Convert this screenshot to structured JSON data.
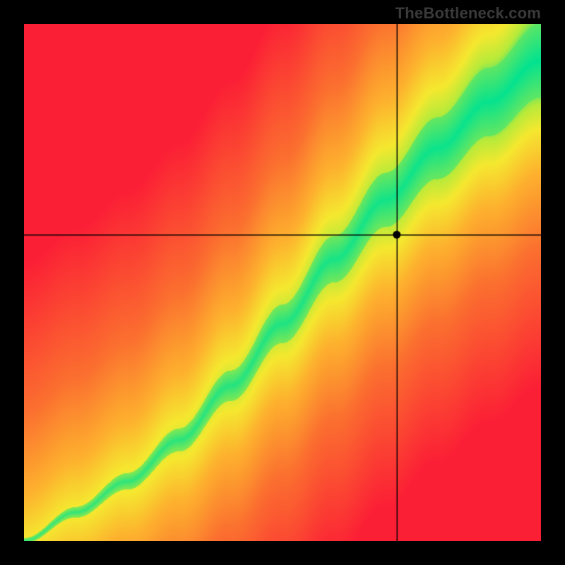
{
  "watermark": "TheBottleneck.com",
  "chart_data": {
    "type": "heatmap",
    "title": "",
    "xlabel": "",
    "ylabel": "",
    "xlim": [
      0,
      1
    ],
    "ylim": [
      0,
      1
    ],
    "marker": {
      "x": 0.722,
      "y": 0.592
    },
    "crosshair": {
      "x": 0.722,
      "y": 0.592
    },
    "ridge": {
      "description": "Green optimal band along a nonlinear diagonal curve",
      "curve": [
        {
          "x": 0.0,
          "y": 0.0
        },
        {
          "x": 0.1,
          "y": 0.055
        },
        {
          "x": 0.2,
          "y": 0.115
        },
        {
          "x": 0.3,
          "y": 0.195
        },
        {
          "x": 0.4,
          "y": 0.3
        },
        {
          "x": 0.5,
          "y": 0.42
        },
        {
          "x": 0.6,
          "y": 0.545
        },
        {
          "x": 0.7,
          "y": 0.66
        },
        {
          "x": 0.8,
          "y": 0.76
        },
        {
          "x": 0.9,
          "y": 0.85
        },
        {
          "x": 1.0,
          "y": 0.93
        }
      ],
      "band_half_width_at_0": 0.005,
      "band_half_width_at_1": 0.075
    },
    "gradient": {
      "description": "Color falls off from green (on ridge) through yellow/orange to red with distance from ridge, plus slight brightening toward top-right",
      "stops": [
        {
          "t": 0.0,
          "color": "#00e291"
        },
        {
          "t": 0.08,
          "color": "#b7ea3a"
        },
        {
          "t": 0.16,
          "color": "#f5e82f"
        },
        {
          "t": 0.3,
          "color": "#fdb22e"
        },
        {
          "t": 0.55,
          "color": "#fb6f2f"
        },
        {
          "t": 1.0,
          "color": "#fb1f35"
        }
      ]
    }
  }
}
